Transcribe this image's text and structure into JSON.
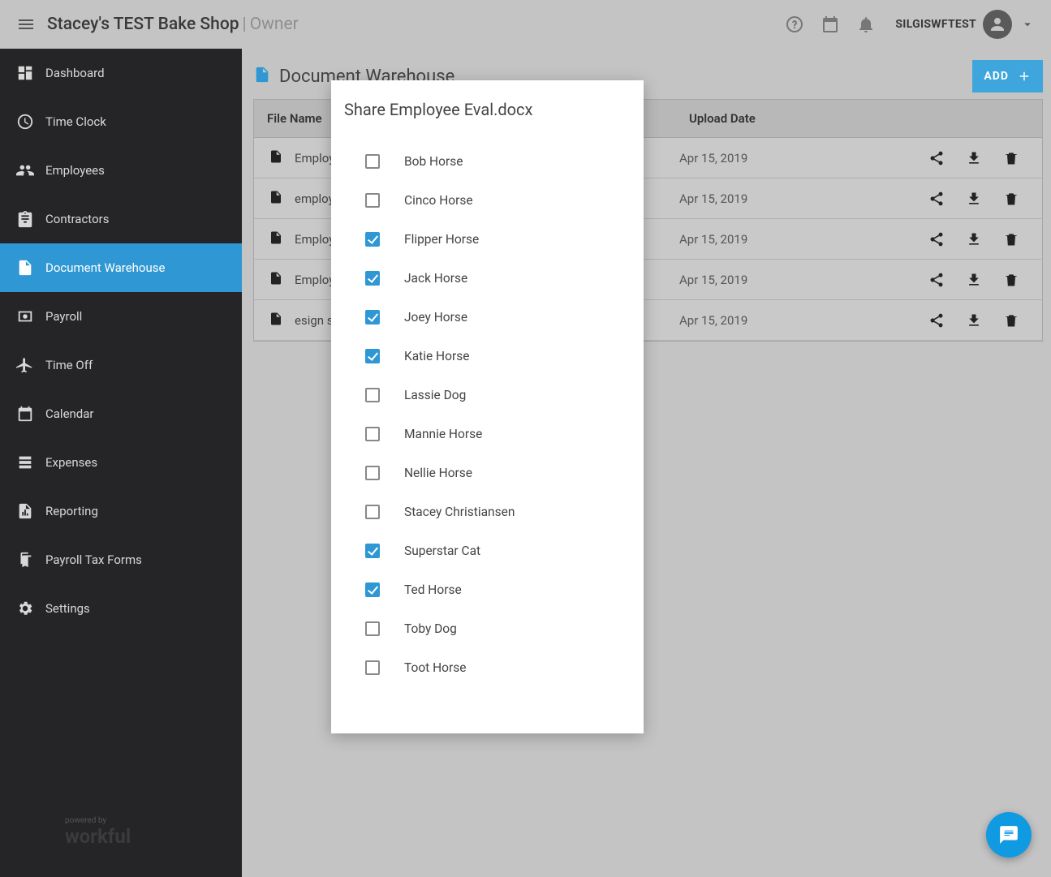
{
  "header": {
    "shop_name": "Stacey's TEST Bake Shop",
    "role_separator": " | ",
    "role": "Owner",
    "username": "SILGISWFTEST"
  },
  "sidebar": {
    "items": [
      {
        "label": "Dashboard",
        "icon": "dashboard"
      },
      {
        "label": "Time Clock",
        "icon": "clock"
      },
      {
        "label": "Employees",
        "icon": "people"
      },
      {
        "label": "Contractors",
        "icon": "clipboard"
      },
      {
        "label": "Document Warehouse",
        "icon": "doc",
        "active": true
      },
      {
        "label": "Payroll",
        "icon": "money"
      },
      {
        "label": "Time Off",
        "icon": "plane"
      },
      {
        "label": "Calendar",
        "icon": "calendar"
      },
      {
        "label": "Expenses",
        "icon": "list"
      },
      {
        "label": "Reporting",
        "icon": "report"
      },
      {
        "label": "Payroll Tax Forms",
        "icon": "forms"
      },
      {
        "label": "Settings",
        "icon": "gear"
      }
    ],
    "footer_powered": "powered by",
    "footer_brand": "workful"
  },
  "page": {
    "title": "Document Warehouse",
    "add_button": "ADD"
  },
  "table": {
    "columns": {
      "file_name": "File Name",
      "upload_date": "Upload Date"
    },
    "rows": [
      {
        "name": "Employe",
        "date": "Apr 15, 2019"
      },
      {
        "name": "employe",
        "date": "Apr 15, 2019"
      },
      {
        "name": "Employe",
        "date": "Apr 15, 2019"
      },
      {
        "name": "Employe",
        "date": "Apr 15, 2019"
      },
      {
        "name": "esign st",
        "date": "Apr 15, 2019"
      }
    ]
  },
  "modal": {
    "title": "Share Employee Eval.docx",
    "employees": [
      {
        "name": "Bob Horse",
        "checked": false
      },
      {
        "name": "Cinco Horse",
        "checked": false
      },
      {
        "name": "Flipper Horse",
        "checked": true
      },
      {
        "name": "Jack Horse",
        "checked": true
      },
      {
        "name": "Joey Horse",
        "checked": true
      },
      {
        "name": "Katie Horse",
        "checked": true
      },
      {
        "name": "Lassie Dog",
        "checked": false
      },
      {
        "name": "Mannie Horse",
        "checked": false
      },
      {
        "name": "Nellie Horse",
        "checked": false
      },
      {
        "name": "Stacey Christiansen",
        "checked": false
      },
      {
        "name": "Superstar Cat",
        "checked": true
      },
      {
        "name": "Ted Horse",
        "checked": true
      },
      {
        "name": "Toby Dog",
        "checked": false
      },
      {
        "name": "Toot Horse",
        "checked": false
      }
    ]
  }
}
